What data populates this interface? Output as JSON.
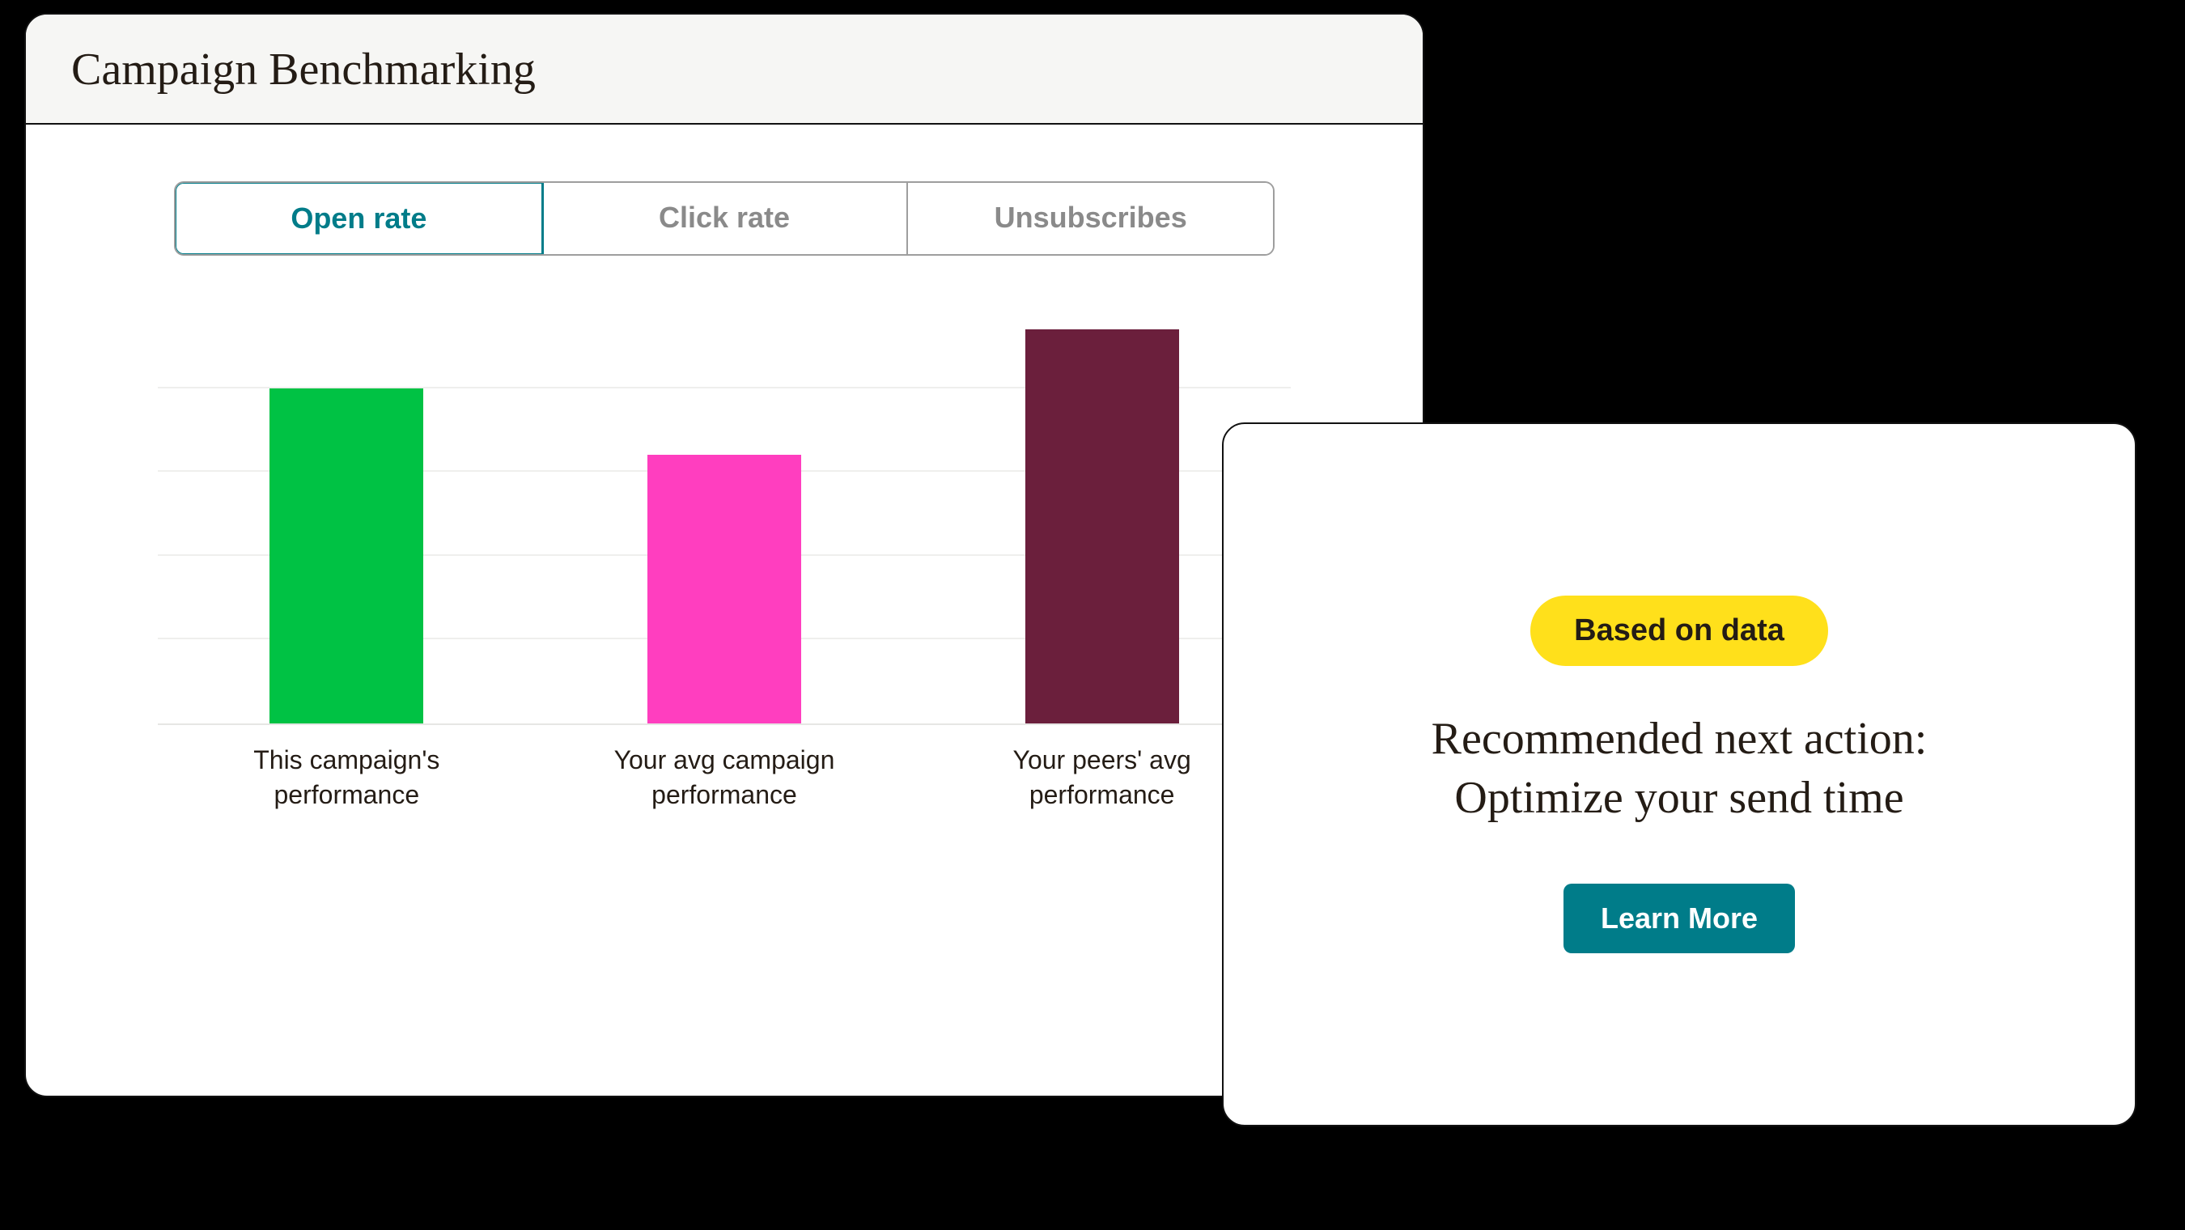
{
  "panel": {
    "title": "Campaign Benchmarking",
    "tabs": [
      {
        "label": "Open rate",
        "active": true
      },
      {
        "label": "Click rate",
        "active": false
      },
      {
        "label": "Unsubscribes",
        "active": false
      }
    ]
  },
  "chart_data": {
    "type": "bar",
    "title": "Campaign Benchmarking",
    "metric": "Open rate",
    "categories": [
      "This campaign's performance",
      "Your avg campaign performance",
      "Your peers' avg performance"
    ],
    "values": [
      4.0,
      3.2,
      4.7
    ],
    "colors": [
      "#00c244",
      "#ff3ebf",
      "#6b1f3c"
    ],
    "ylim": [
      0,
      5
    ],
    "gridlines": 5,
    "xlabel": "",
    "ylabel": ""
  },
  "recommendation": {
    "badge": "Based on data",
    "text_line1": "Recommended next action:",
    "text_line2": "Optimize your send time",
    "cta": "Learn More"
  }
}
